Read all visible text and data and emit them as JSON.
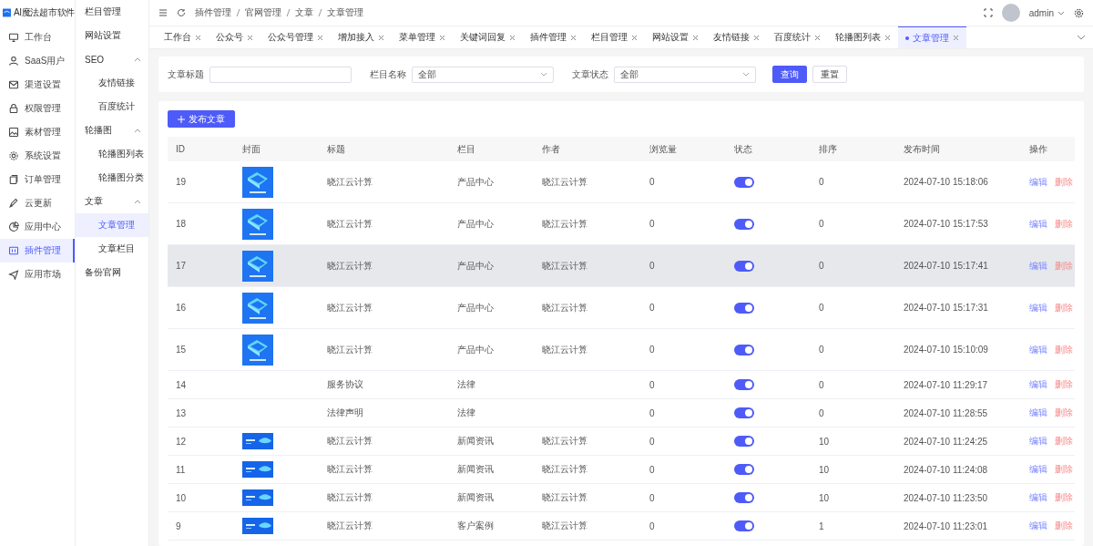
{
  "brand": {
    "name": "AI魔法超市软件"
  },
  "rail": [
    {
      "label": "工作台",
      "selected": false
    },
    {
      "label": "SaaS用户",
      "selected": false
    },
    {
      "label": "渠道设置",
      "selected": false
    },
    {
      "label": "权限管理",
      "selected": false
    },
    {
      "label": "素材管理",
      "selected": false
    },
    {
      "label": "系统设置",
      "selected": false
    },
    {
      "label": "订单管理",
      "selected": false
    },
    {
      "label": "云更新",
      "selected": false
    },
    {
      "label": "应用中心",
      "selected": false
    },
    {
      "label": "插件管理",
      "selected": true
    },
    {
      "label": "应用市场",
      "selected": false
    }
  ],
  "submenu": [
    {
      "label": "栏目管理",
      "selected": false
    },
    {
      "label": "网站设置",
      "selected": false
    },
    {
      "label": "SEO",
      "expanded": true,
      "children": [
        {
          "label": "友情链接",
          "selected": false
        },
        {
          "label": "百度统计",
          "selected": false
        }
      ]
    },
    {
      "label": "轮播图",
      "expanded": true,
      "children": [
        {
          "label": "轮播图列表",
          "selected": false
        },
        {
          "label": "轮播图分类",
          "selected": false
        }
      ]
    },
    {
      "label": "文章",
      "expanded": true,
      "children": [
        {
          "label": "文章管理",
          "selected": true
        },
        {
          "label": "文章栏目",
          "selected": false
        }
      ]
    },
    {
      "label": "备份官网",
      "selected": false
    }
  ],
  "breadcrumb": [
    "插件管理",
    "官网管理",
    "文章",
    "文章管理"
  ],
  "user": {
    "name": "admin"
  },
  "tabs": [
    {
      "label": "工作台",
      "selected": false
    },
    {
      "label": "公众号",
      "selected": false
    },
    {
      "label": "公众号管理",
      "selected": false
    },
    {
      "label": "增加接入",
      "selected": false
    },
    {
      "label": "菜单管理",
      "selected": false
    },
    {
      "label": "关键词回复",
      "selected": false
    },
    {
      "label": "插件管理",
      "selected": false
    },
    {
      "label": "栏目管理",
      "selected": false
    },
    {
      "label": "网站设置",
      "selected": false
    },
    {
      "label": "友情链接",
      "selected": false
    },
    {
      "label": "百度统计",
      "selected": false
    },
    {
      "label": "轮播图列表",
      "selected": false
    },
    {
      "label": "文章管理",
      "selected": true
    }
  ],
  "filters": [
    {
      "label": "文章标题",
      "kind": "text"
    },
    {
      "label": "栏目名称",
      "kind": "select",
      "value": "全部"
    },
    {
      "label": "文章状态",
      "kind": "select",
      "value": "全部"
    }
  ],
  "search_button": "查询",
  "reset_button": "重置",
  "add_button": "发布文章",
  "table": {
    "columns": [
      "ID",
      "封面",
      "标题",
      "栏目",
      "作者",
      "浏览量",
      "状态",
      "排序",
      "发布时间",
      "操作"
    ],
    "rows": [
      {
        "id": "19",
        "title": "晓江云计算",
        "column": "产品中心",
        "author": "晓江云计算",
        "views": "0",
        "on": true,
        "sort": "0",
        "time": "2024-07-10 15:18:06",
        "edit": "编辑",
        "delete": "删除",
        "selected": false
      },
      {
        "id": "18",
        "title": "晓江云计算",
        "column": "产品中心",
        "author": "晓江云计算",
        "views": "0",
        "on": true,
        "sort": "0",
        "time": "2024-07-10 15:17:53",
        "edit": "编辑",
        "delete": "删除",
        "selected": false
      },
      {
        "id": "17",
        "title": "晓江云计算",
        "column": "产品中心",
        "author": "晓江云计算",
        "views": "0",
        "on": true,
        "sort": "0",
        "time": "2024-07-10 15:17:41",
        "edit": "编辑",
        "delete": "删除",
        "selected": true
      },
      {
        "id": "16",
        "title": "晓江云计算",
        "column": "产品中心",
        "author": "晓江云计算",
        "views": "0",
        "on": true,
        "sort": "0",
        "time": "2024-07-10 15:17:31",
        "edit": "编辑",
        "delete": "删除",
        "selected": false
      },
      {
        "id": "15",
        "title": "晓江云计算",
        "column": "产品中心",
        "author": "晓江云计算",
        "views": "0",
        "on": true,
        "sort": "0",
        "time": "2024-07-10 15:10:09",
        "edit": "编辑",
        "delete": "删除",
        "selected": false
      },
      {
        "id": "14",
        "title": "服务协议",
        "column": "法律",
        "views": "0",
        "on": true,
        "sort": "0",
        "time": "2024-07-10 11:29:17",
        "edit": "编辑",
        "delete": "删除",
        "selected": false
      },
      {
        "id": "13",
        "title": "法律声明",
        "column": "法律",
        "views": "0",
        "on": true,
        "sort": "0",
        "time": "2024-07-10 11:28:55",
        "edit": "编辑",
        "delete": "删除",
        "selected": false
      },
      {
        "id": "12",
        "title": "晓江云计算",
        "column": "新闻资讯",
        "author": "晓江云计算",
        "views": "0",
        "on": true,
        "sort": "10",
        "time": "2024-07-10 11:24:25",
        "edit": "编辑",
        "delete": "删除",
        "selected": false
      },
      {
        "id": "11",
        "title": "晓江云计算",
        "column": "新闻资讯",
        "author": "晓江云计算",
        "views": "0",
        "on": true,
        "sort": "10",
        "time": "2024-07-10 11:24:08",
        "edit": "编辑",
        "delete": "删除",
        "selected": false
      },
      {
        "id": "10",
        "title": "晓江云计算",
        "column": "新闻资讯",
        "author": "晓江云计算",
        "views": "0",
        "on": true,
        "sort": "10",
        "time": "2024-07-10 11:23:50",
        "edit": "编辑",
        "delete": "删除",
        "selected": false
      },
      {
        "id": "9",
        "title": "晓江云计算",
        "column": "客户案例",
        "author": "晓江云计算",
        "views": "0",
        "on": true,
        "sort": "1",
        "time": "2024-07-10 11:23:01",
        "edit": "编辑",
        "delete": "删除",
        "selected": false
      }
    ]
  }
}
